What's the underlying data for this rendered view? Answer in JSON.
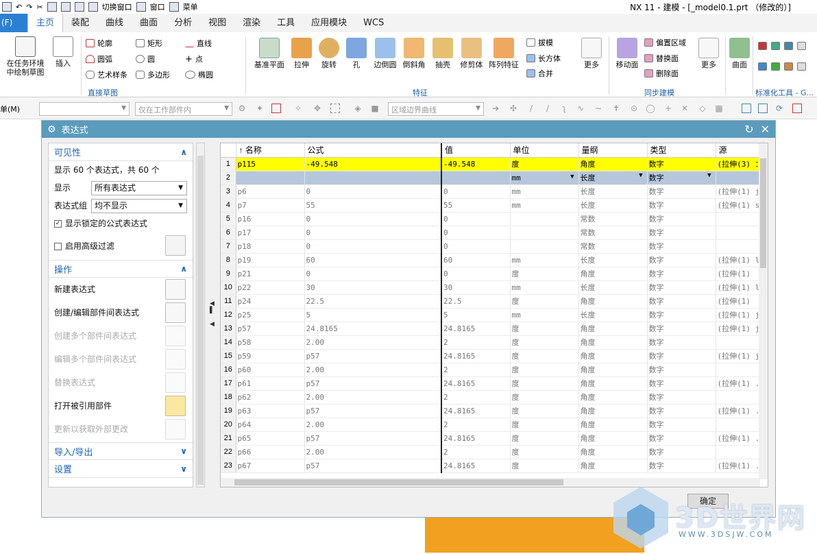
{
  "window": {
    "title": "NX 11 - 建模 - [_model0.1.prt （修改的）]",
    "menu_label": "菜单",
    "switch_window": "切换窗口",
    "window_menu": "窗口"
  },
  "tabs": {
    "file": "(F)",
    "items": [
      "主页",
      "装配",
      "曲线",
      "曲面",
      "分析",
      "视图",
      "渲染",
      "工具",
      "应用模块",
      "WCS"
    ]
  },
  "ribbon": {
    "sketch_task": "在任务环境中绘制草图",
    "sketch_task2": "中绘制草图",
    "insert": "插入",
    "small": [
      "轮廓",
      "矩形",
      "直线",
      "圆弧",
      "圆",
      "点",
      "艺术样条",
      "多边形",
      "椭圆"
    ],
    "group_direct_sketch": "直接草图",
    "features": [
      "基准平面",
      "拉伸",
      "旋转",
      "孔",
      "边倒圆",
      "倒斜角",
      "抽壳",
      "修剪体",
      "阵列特征"
    ],
    "features_small": [
      "拔模",
      "长方体",
      "合并"
    ],
    "more": "更多",
    "group_feature": "特征",
    "sync": [
      "移动面",
      "偏置区域",
      "替换面",
      "删除面"
    ],
    "more2": "更多",
    "group_sync": "同步建模",
    "surface": "曲面",
    "group_std": "标准化工具 - G..."
  },
  "toolbar2": {
    "menu": "单(M)",
    "filter_placeholder": "",
    "scope": "仅在工作部件内",
    "curve_rule": "区域边界曲线"
  },
  "dialog": {
    "title": "表达式",
    "visibility": {
      "header": "可见性",
      "count_text": "显示 60 个表达式，共 60 个",
      "show_label": "显示",
      "show_value": "所有表达式",
      "group_label": "表达式组",
      "group_value": "均不显示",
      "locked_formula": "显示锁定的公式表达式",
      "adv_filter": "启用高级过滤"
    },
    "actions": {
      "header": "操作",
      "items": [
        "新建表达式",
        "创建/编辑部件间表达式",
        "创建多个部件间表达式",
        "编辑多个部件间表达式",
        "替换表达式",
        "打开被引用部件",
        "更新以获取外部更改"
      ]
    },
    "import_export": "导入/导出",
    "settings": "设置",
    "columns": [
      "名称",
      "公式",
      "值",
      "单位",
      "量纲",
      "类型",
      "源"
    ],
    "rows": [
      [
        "1",
        "p115",
        "-49.548",
        "-49.548",
        "度",
        "角度",
        "数字",
        "(拉伸(3) ："
      ],
      [
        "2",
        "",
        "",
        "",
        "mm",
        "长度",
        "数字",
        ""
      ],
      [
        "3",
        "p6",
        "0",
        "0",
        "mm",
        "长度",
        "数字",
        "(拉伸(1) j"
      ],
      [
        "4",
        "p7",
        "55",
        "55",
        "mm",
        "长度",
        "数字",
        "(拉伸(1) s"
      ],
      [
        "5",
        "p16",
        "0",
        "0",
        "",
        "常数",
        "数字",
        ""
      ],
      [
        "6",
        "p17",
        "0",
        "0",
        "",
        "常数",
        "数字",
        ""
      ],
      [
        "7",
        "p18",
        "0",
        "0",
        "",
        "常数",
        "数字",
        ""
      ],
      [
        "8",
        "p19",
        "60",
        "60",
        "mm",
        "长度",
        "数字",
        "(拉伸(1) l"
      ],
      [
        "9",
        "p21",
        "0",
        "0",
        "度",
        "角度",
        "数字",
        "(拉伸(1)"
      ],
      [
        "10",
        "p22",
        "30",
        "30",
        "mm",
        "长度",
        "数字",
        "(拉伸(1) l"
      ],
      [
        "11",
        "p24",
        "22.5",
        "22.5",
        "度",
        "角度",
        "数字",
        "(拉伸(1)"
      ],
      [
        "12",
        "p25",
        "5",
        "5",
        "mm",
        "长度",
        "数字",
        "(拉伸(1) j"
      ],
      [
        "13",
        "p57",
        "24.8165",
        "24.8165",
        "度",
        "角度",
        "数字",
        "(拉伸(1) j"
      ],
      [
        "14",
        "p58",
        "2.00",
        "2",
        "度",
        "角度",
        "数字",
        ""
      ],
      [
        "15",
        "p59",
        "p57",
        "24.8165",
        "度",
        "角度",
        "数字",
        "(拉伸(1) j"
      ],
      [
        "16",
        "p60",
        "2.00",
        "2",
        "度",
        "角度",
        "数字",
        ""
      ],
      [
        "17",
        "p61",
        "p57",
        "24.8165",
        "度",
        "角度",
        "数字",
        "(拉伸(1) ."
      ],
      [
        "18",
        "p62",
        "2.00",
        "2",
        "度",
        "角度",
        "数字",
        ""
      ],
      [
        "19",
        "p63",
        "p57",
        "24.8165",
        "度",
        "角度",
        "数字",
        "(拉伸(1) ."
      ],
      [
        "20",
        "p64",
        "2.00",
        "2",
        "度",
        "角度",
        "数字",
        ""
      ],
      [
        "21",
        "p65",
        "p57",
        "24.8165",
        "度",
        "角度",
        "数字",
        "(拉伸(1) ."
      ],
      [
        "22",
        "p66",
        "2.00",
        "2",
        "度",
        "角度",
        "数字",
        ""
      ],
      [
        "23",
        "p67",
        "p57",
        "24.8165",
        "度",
        "角度",
        "数字",
        "(拉伸(1) ."
      ]
    ],
    "ok_button": "确定"
  },
  "watermark": {
    "logo": "3D世界网",
    "url": "WWW.3DSJW.COM"
  }
}
